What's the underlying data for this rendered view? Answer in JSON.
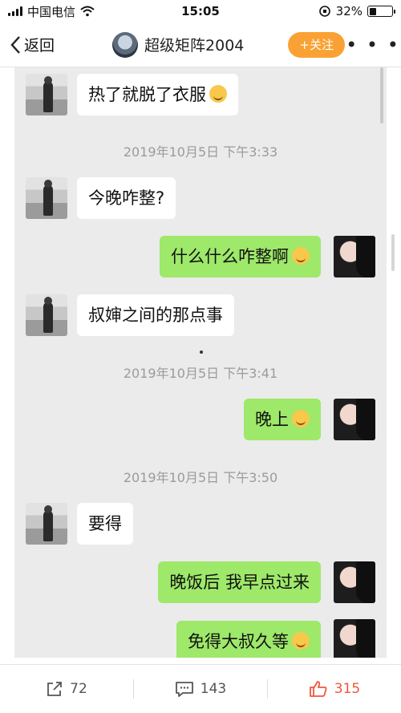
{
  "status_bar": {
    "carrier": "中国电信",
    "time": "15:05",
    "battery": "32%",
    "battery_level": 0.32
  },
  "nav": {
    "back_label": "返回",
    "title": "超级矩阵2004",
    "follow_label": "+关注",
    "more_label": "• • •"
  },
  "messages": [
    {
      "side": "left",
      "text": "热了就脱了衣服",
      "icon": "laughing-emoji"
    },
    {
      "type": "timestamp",
      "text": "2019年10月5日 下午3:33"
    },
    {
      "side": "left",
      "text": "今晚咋整?"
    },
    {
      "side": "right",
      "text": "什么什么咋整啊",
      "icon": "smile-emoji"
    },
    {
      "side": "left",
      "text": "叔婶之间的那点事"
    },
    {
      "type": "timestamp",
      "text": "2019年10月5日 下午3:41"
    },
    {
      "side": "right",
      "text": "晚上",
      "icon": "tongue-emoji"
    },
    {
      "type": "timestamp",
      "text": "2019年10月5日 下午3:50"
    },
    {
      "side": "left",
      "text": "要得"
    },
    {
      "side": "right",
      "text": "晚饭后 我早点过来"
    },
    {
      "side": "right",
      "text": "免得大叔久等",
      "icon": "tongue-emoji"
    }
  ],
  "actions": {
    "share_count": "72",
    "comment_count": "143",
    "like_count": "315"
  },
  "colors": {
    "follow": "#f9a233",
    "bubble_right": "#9ee86a",
    "like": "#f0563c"
  }
}
